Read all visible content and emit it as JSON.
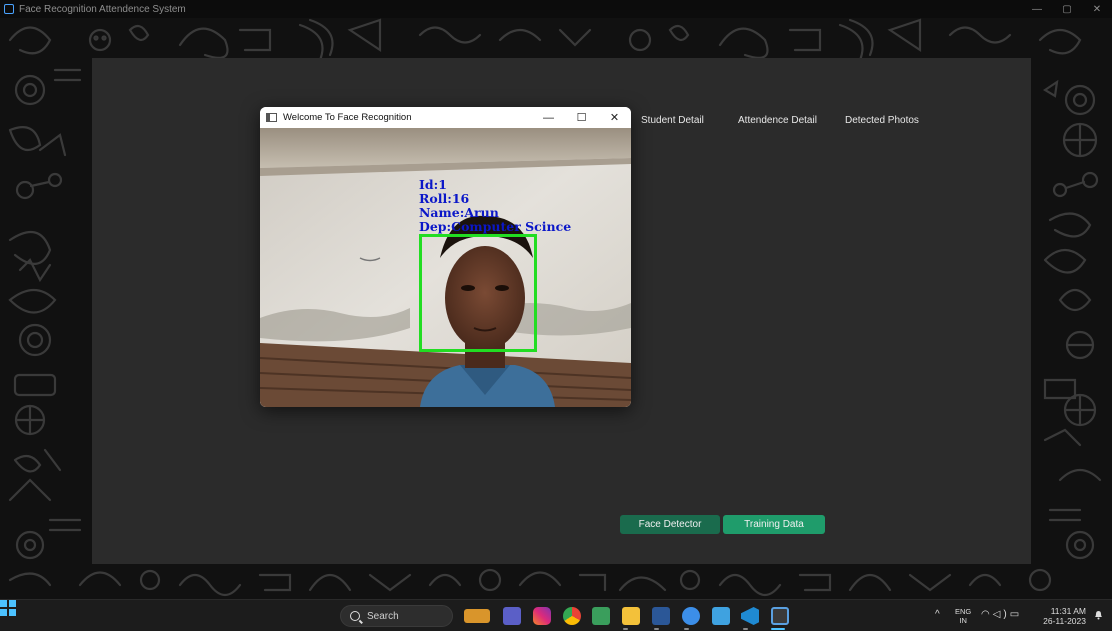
{
  "app": {
    "title": "Face Recognition Attendence System"
  },
  "nav": {
    "student_detail": "Student Detail",
    "attendence_detail": "Attendence Detail",
    "detected_photos": "Detected Photos"
  },
  "buttons": {
    "face_detector": "Face Detector",
    "training_data": "Training Data"
  },
  "camera_window": {
    "title": "Welcome To Face Recognition",
    "overlay": {
      "id": "Id:1",
      "roll": "Roll:16",
      "name": "Name:Arun",
      "dep": "Dep:Computer Scince"
    }
  },
  "taskbar": {
    "search_label": "Search",
    "lang_top": "ENG",
    "lang_bottom": "IN",
    "time": "11:31 AM",
    "date": "26-11-2023"
  },
  "colors": {
    "panel": "#2b2b2b",
    "button_dark_green": "#1a6b4d",
    "button_green": "#1f9c6b",
    "overlay_text": "#0b17c8",
    "face_box": "#22dd22"
  }
}
